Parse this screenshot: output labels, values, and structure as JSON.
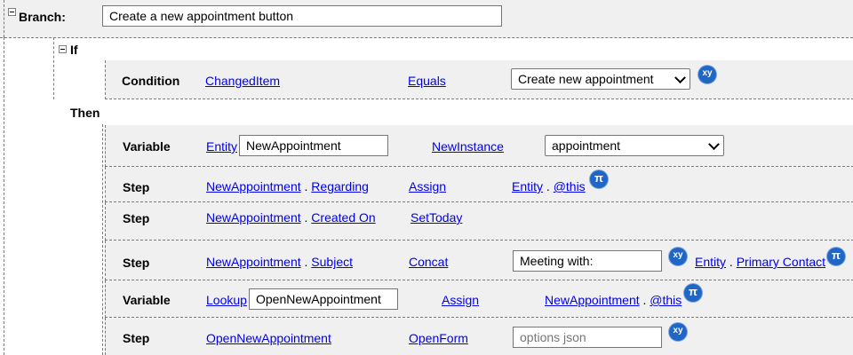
{
  "branch": {
    "label": "Branch:",
    "name_value": "Create a new appointment button"
  },
  "if_block": {
    "label": "If",
    "condition": {
      "label": "Condition",
      "field": "ChangedItem",
      "operator": "Equals",
      "value": "Create new appointment",
      "badge": "xy"
    }
  },
  "then_label": "Then",
  "rows": [
    {
      "type": "Variable",
      "c1": "Entity",
      "input": "NewAppointment",
      "c3": "NewInstance",
      "select": "appointment"
    },
    {
      "type": "Step",
      "c1a": "NewAppointment",
      "sep1": " . ",
      "c1b": "Regarding",
      "c2": "Assign",
      "c3a": "Entity",
      "sep2": " . ",
      "c3b": "@this",
      "badge": "π"
    },
    {
      "type": "Step",
      "c1a": "NewAppointment",
      "sep1": " . ",
      "c1b": "Created On",
      "c2": "SetToday"
    },
    {
      "type": "Step",
      "c1a": "NewAppointment",
      "sep1": " . ",
      "c1b": "Subject",
      "c2": "Concat",
      "input": "Meeting with:",
      "badge1": "xy",
      "c3a": "Entity",
      "sep2": " . ",
      "c3b": "Primary Contact",
      "badge2": "π"
    },
    {
      "type": "Variable",
      "c1": "Lookup",
      "input": "OpenNewAppointment",
      "c2": "Assign",
      "c3a": "NewAppointment",
      "sep2": " . ",
      "c3b": "@this",
      "badge": "π"
    },
    {
      "type": "Step",
      "c1": "OpenNewAppointment",
      "c2": "OpenForm",
      "placeholder": "options json",
      "badge": "xy"
    }
  ]
}
